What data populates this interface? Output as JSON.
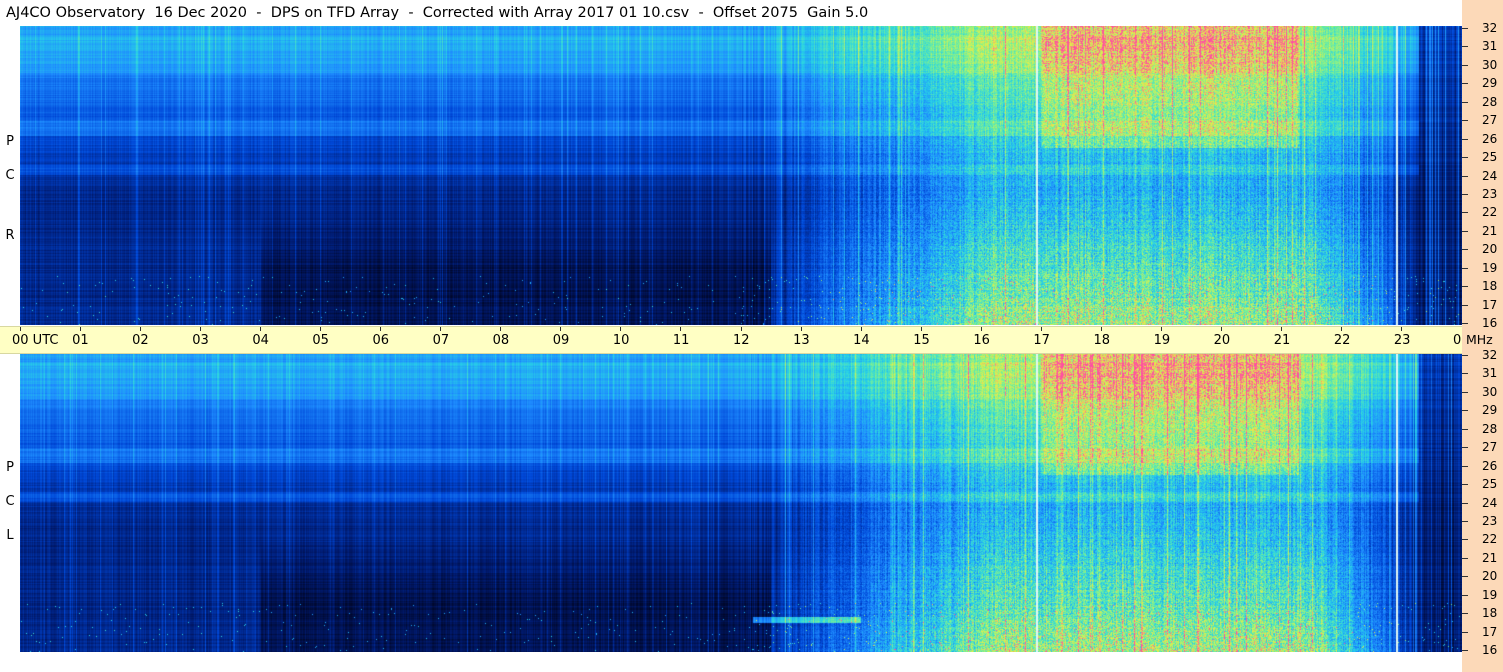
{
  "title": "AJ4CO Observatory  16 Dec 2020  -  DPS on TFD Array  -  Corrected with Array 2017 01 10.csv  -  Offset 2075  Gain 5.0",
  "chart_data": {
    "type": "heatmap",
    "title": "AJ4CO Observatory  16 Dec 2020  -  DPS on TFD Array  -  Corrected with Array 2017 01 10.csv  -  Offset 2075  Gain 5.0",
    "xlabel": "UTC",
    "ylabel": "MHz",
    "x_ticks": [
      "00",
      "01",
      "02",
      "03",
      "04",
      "05",
      "06",
      "07",
      "08",
      "09",
      "10",
      "11",
      "12",
      "13",
      "14",
      "15",
      "16",
      "17",
      "18",
      "19",
      "20",
      "21",
      "22",
      "23",
      "00"
    ],
    "x_first_label": "00  UTC",
    "xlim": [
      0,
      24
    ],
    "y_ticks": [
      16,
      17,
      18,
      19,
      20,
      21,
      22,
      23,
      24,
      25,
      26,
      27,
      28,
      29,
      30,
      31,
      32
    ],
    "ylim": [
      16,
      32
    ],
    "freq_unit": "MHz",
    "panels": [
      {
        "name": "RCP",
        "letters": [
          "R",
          "C",
          "P"
        ]
      },
      {
        "name": "LCP",
        "letters": [
          "L",
          "C",
          "P"
        ]
      }
    ],
    "colormap": [
      "#000010",
      "#001a6e",
      "#0048d8",
      "#1e8cff",
      "#28d2e6",
      "#78f096",
      "#e6f046",
      "#ff50a0"
    ],
    "markers_utc": [
      16.92,
      22.92
    ],
    "marker_colors": [
      "#dff7f5",
      "#dff7f5"
    ]
  }
}
